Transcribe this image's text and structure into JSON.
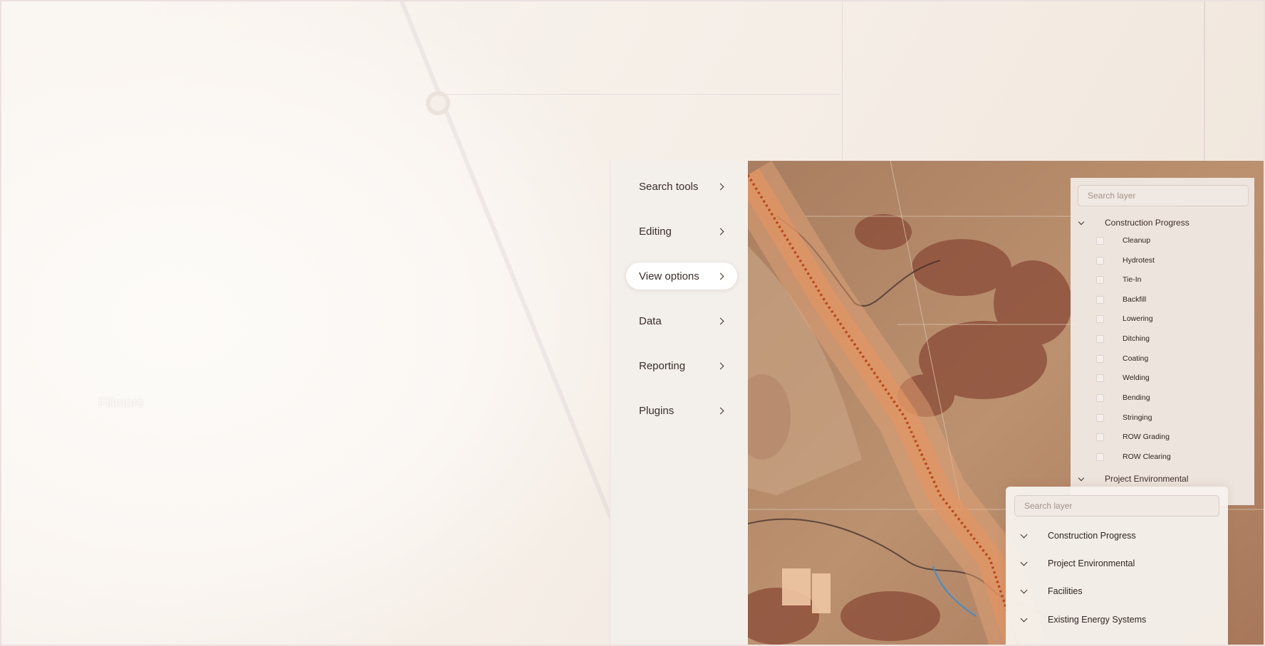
{
  "background_map": {
    "place_label": "Fillmore"
  },
  "menu": {
    "items": [
      {
        "label": "Search tools",
        "active": false
      },
      {
        "label": "Editing",
        "active": false
      },
      {
        "label": "View options",
        "active": true
      },
      {
        "label": "Data",
        "active": false
      },
      {
        "label": "Reporting",
        "active": false
      },
      {
        "label": "Plugins",
        "active": false
      }
    ]
  },
  "layer_panel": {
    "search_placeholder": "Search layer",
    "groups": [
      {
        "label": "Construction Progress",
        "expanded": true,
        "layers": [
          {
            "label": "Cleanup",
            "checked": false
          },
          {
            "label": "Hydrotest",
            "checked": false
          },
          {
            "label": "Tie-In",
            "checked": false
          },
          {
            "label": "Backfill",
            "checked": false
          },
          {
            "label": "Lowering",
            "checked": false
          },
          {
            "label": "Ditching",
            "checked": false
          },
          {
            "label": "Coating",
            "checked": false
          },
          {
            "label": "Welding",
            "checked": false
          },
          {
            "label": "Bending",
            "checked": false
          },
          {
            "label": "Stringing",
            "checked": false
          },
          {
            "label": "ROW Grading",
            "checked": false
          },
          {
            "label": "ROW Clearing",
            "checked": false
          }
        ]
      },
      {
        "label": "Project Environmental",
        "expanded": true
      }
    ]
  },
  "popup_panel": {
    "search_placeholder": "Search layer",
    "groups": [
      {
        "label": "Construction Progress"
      },
      {
        "label": "Project Environmental"
      },
      {
        "label": "Facilities"
      },
      {
        "label": "Existing Energy Systems"
      }
    ]
  },
  "colors": {
    "accent": "#d9743e",
    "pipeline_dots": "#b8481c",
    "menu_bg": "#f3efeb",
    "panel_bg": "#f0eae4"
  }
}
